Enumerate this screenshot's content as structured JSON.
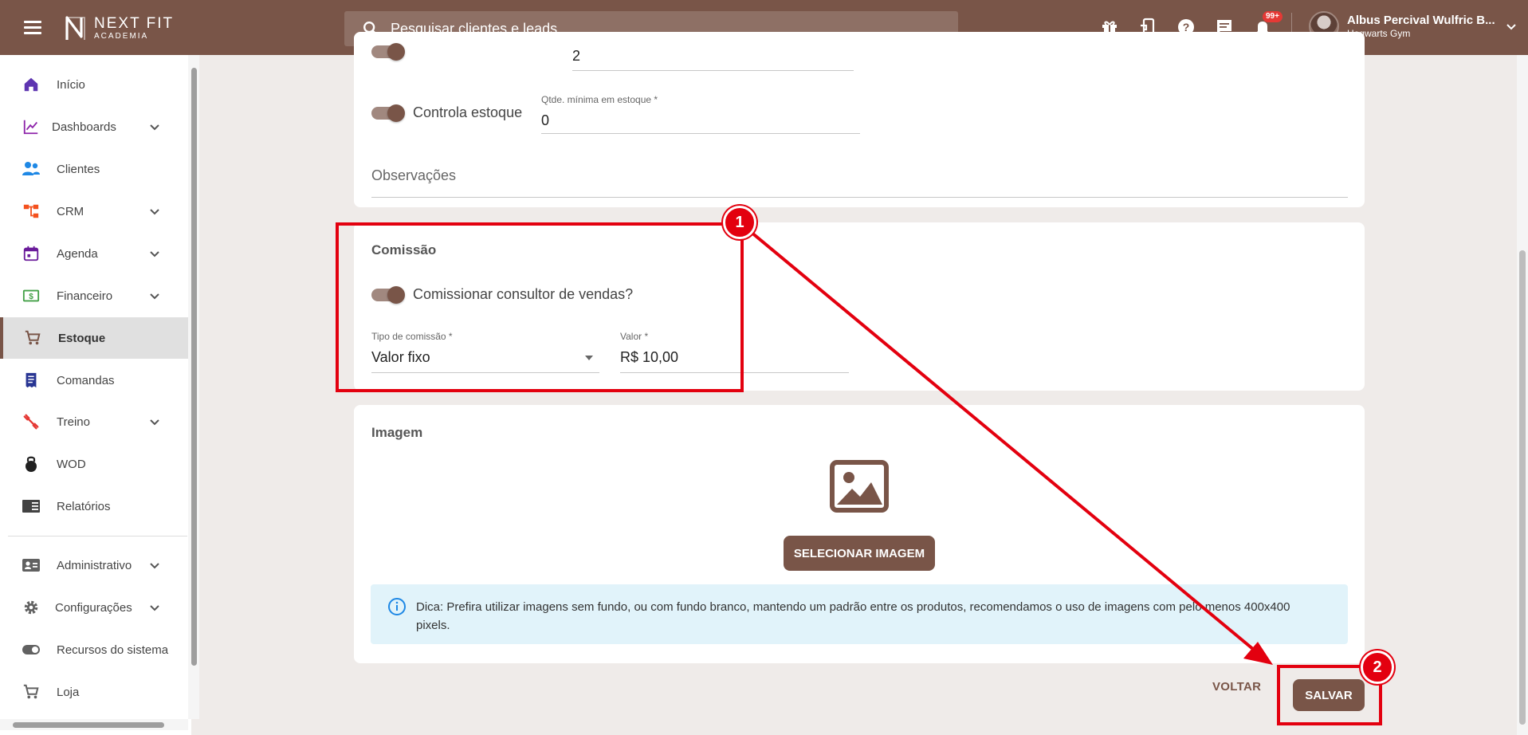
{
  "app": {
    "logo_line1": "NEXT FIT",
    "logo_line2": "ACADEMIA",
    "search_placeholder": "Pesquisar clientes e leads",
    "notification_badge": "99+",
    "user_name": "Albus Percival Wulfric B...",
    "user_gym": "Hogwarts Gym",
    "brand_color": "#795548",
    "annotation_color": "#e3000f"
  },
  "sidebar": {
    "items": [
      {
        "label": "Início",
        "icon": "home-icon",
        "color": "#5e35b1"
      },
      {
        "label": "Dashboards",
        "icon": "chart-line-icon",
        "color": "#8e24aa"
      },
      {
        "label": "Clientes",
        "icon": "people-icon",
        "color": "#1e88e5"
      },
      {
        "label": "CRM",
        "icon": "crm-tree-icon",
        "color": "#f4511e"
      },
      {
        "label": "Agenda",
        "icon": "calendar-icon",
        "color": "#6a1b9a"
      },
      {
        "label": "Financeiro",
        "icon": "money-icon",
        "color": "#43a047"
      },
      {
        "label": "Estoque",
        "icon": "cart-icon",
        "color": "#795548"
      },
      {
        "label": "Comandas",
        "icon": "receipt-icon",
        "color": "#283593"
      },
      {
        "label": "Treino",
        "icon": "dumbbell-icon",
        "color": "#e53935"
      },
      {
        "label": "WOD",
        "icon": "kettlebell-icon",
        "color": "#212121"
      },
      {
        "label": "Relatórios",
        "icon": "report-icon",
        "color": "#424242"
      },
      {
        "label": "Administrativo",
        "icon": "id-card-icon",
        "color": "#616161"
      },
      {
        "label": "Configurações",
        "icon": "gear-icon",
        "color": "#616161"
      },
      {
        "label": "Recursos do sistema",
        "icon": "toggle-icon",
        "color": "#616161"
      },
      {
        "label": "Loja",
        "icon": "shop-cart-icon",
        "color": "#616161"
      }
    ]
  },
  "form": {
    "top_partial_value": "2",
    "controla_estoque_label": "Controla estoque",
    "qtde_minima_label": "Qtde. mínima em estoque *",
    "qtde_minima_value": "0",
    "observacoes_label": "Observações",
    "comissao_title": "Comissão",
    "comissionar_label": "Comissionar consultor de vendas?",
    "tipo_comissao_label": "Tipo de comissão *",
    "tipo_comissao_value": "Valor fixo",
    "valor_label": "Valor *",
    "valor_value": "R$ 10,00",
    "imagem_title": "Imagem",
    "selecionar_imagem": "SELECIONAR IMAGEM",
    "dica": "Dica: Prefira utilizar imagens sem fundo, ou com fundo branco, mantendo um padrão entre os produtos, recomendamos o uso de imagens com pelo menos 400x400 pixels.",
    "voltar": "VOLTAR",
    "salvar": "SALVAR"
  },
  "annotations": {
    "marker1": "1",
    "marker2": "2"
  }
}
